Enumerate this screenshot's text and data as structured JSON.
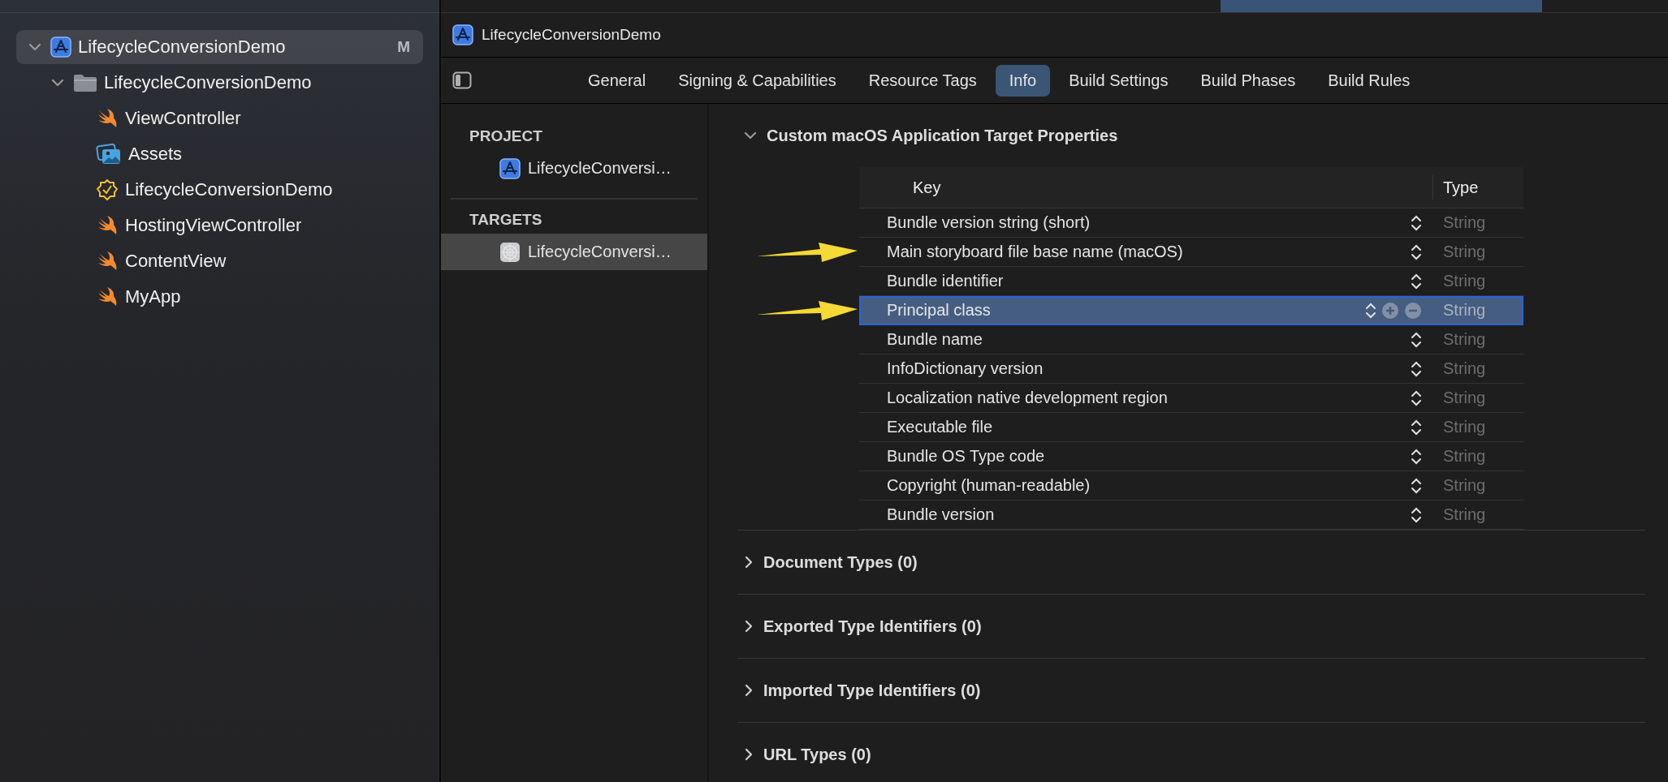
{
  "navigator": {
    "items": [
      {
        "label": "LifecycleConversionDemo",
        "kind": "project",
        "expanded": true,
        "selected": true,
        "badge": "M",
        "children": [
          {
            "label": "LifecycleConversionDemo",
            "kind": "folder",
            "expanded": true,
            "selected": false,
            "children": [
              {
                "label": "ViewController",
                "kind": "swift",
                "selected": false
              },
              {
                "label": "Assets",
                "kind": "assets",
                "selected": false
              },
              {
                "label": "LifecycleConversionDemo",
                "kind": "entitlements",
                "selected": false
              },
              {
                "label": "HostingViewController",
                "kind": "swift",
                "selected": false
              },
              {
                "label": "ContentView",
                "kind": "swift",
                "selected": false
              },
              {
                "label": "MyApp",
                "kind": "swift",
                "selected": false
              }
            ]
          }
        ]
      }
    ]
  },
  "editor": {
    "title": "LifecycleConversionDemo",
    "tabs": [
      {
        "label": "General",
        "selected": false
      },
      {
        "label": "Signing & Capabilities",
        "selected": false
      },
      {
        "label": "Resource Tags",
        "selected": false
      },
      {
        "label": "Info",
        "selected": true
      },
      {
        "label": "Build Settings",
        "selected": false
      },
      {
        "label": "Build Phases",
        "selected": false
      },
      {
        "label": "Build Rules",
        "selected": false
      }
    ],
    "targets_panel": {
      "groups": [
        {
          "heading": "PROJECT",
          "items": [
            {
              "label": "LifecycleConversi…",
              "kind": "project",
              "selected": false
            }
          ]
        },
        {
          "heading": "TARGETS",
          "items": [
            {
              "label": "LifecycleConversi…",
              "kind": "app",
              "selected": true
            }
          ]
        }
      ]
    },
    "sections": [
      {
        "title": "Custom macOS Application Target Properties",
        "expanded": true,
        "columns": [
          "Key",
          "Type"
        ],
        "rows": [
          {
            "key": "Bundle version string (short)",
            "type": "String",
            "selected": false,
            "arrow": false
          },
          {
            "key": "Main storyboard file base name (macOS)",
            "type": "String",
            "selected": false,
            "arrow": true
          },
          {
            "key": "Bundle identifier",
            "type": "String",
            "selected": false,
            "arrow": false
          },
          {
            "key": "Principal class",
            "type": "String",
            "selected": true,
            "arrow": true
          },
          {
            "key": "Bundle name",
            "type": "String",
            "selected": false,
            "arrow": false
          },
          {
            "key": "InfoDictionary version",
            "type": "String",
            "selected": false,
            "arrow": false
          },
          {
            "key": "Localization native development region",
            "type": "String",
            "selected": false,
            "arrow": false
          },
          {
            "key": "Executable file",
            "type": "String",
            "selected": false,
            "arrow": false
          },
          {
            "key": "Bundle OS Type code",
            "type": "String",
            "selected": false,
            "arrow": false
          },
          {
            "key": "Copyright (human-readable)",
            "type": "String",
            "selected": false,
            "arrow": false
          },
          {
            "key": "Bundle version",
            "type": "String",
            "selected": false,
            "arrow": false
          }
        ]
      },
      {
        "title": "Document Types (0)",
        "expanded": false
      },
      {
        "title": "Exported Type Identifiers (0)",
        "expanded": false
      },
      {
        "title": "Imported Type Identifiers (0)",
        "expanded": false
      },
      {
        "title": "URL Types (0)",
        "expanded": false
      }
    ]
  }
}
